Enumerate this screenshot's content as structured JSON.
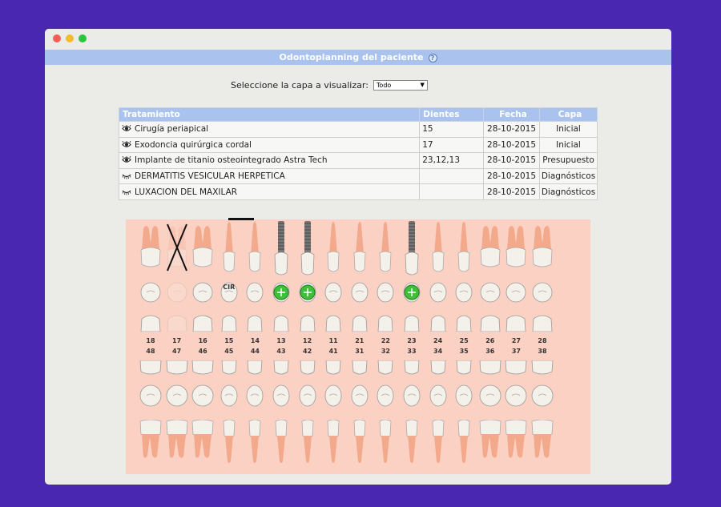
{
  "window": {
    "title": "Odontoplanning del paciente"
  },
  "layer_selector": {
    "label": "Seleccione la capa a visualizar:",
    "value": "Todo"
  },
  "table": {
    "headers": [
      "Tratamiento",
      "Dientes",
      "Fecha",
      "Capa"
    ],
    "rows": [
      {
        "icon": "eye-open-icon",
        "treatment": "Cirugía periapical",
        "teeth": "15",
        "date": "28-10-2015",
        "layer": "Inicial"
      },
      {
        "icon": "eye-open-icon",
        "treatment": "Exodoncia quirúrgica cordal",
        "teeth": "17",
        "date": "28-10-2015",
        "layer": "Inicial"
      },
      {
        "icon": "eye-open-icon",
        "treatment": "Implante de titanio osteointegrado Astra Tech",
        "teeth": "23,12,13",
        "date": "28-10-2015",
        "layer": "Presupuesto"
      },
      {
        "icon": "eye-closed-icon",
        "treatment": "DERMATITIS VESICULAR HERPETICA",
        "teeth": "",
        "date": "28-10-2015",
        "layer": "Diagnósticos"
      },
      {
        "icon": "eye-closed-icon",
        "treatment": "LUXACION DEL MAXILAR",
        "teeth": "",
        "date": "28-10-2015",
        "layer": "Diagnósticos"
      }
    ]
  },
  "odontogram": {
    "upper_numbers": [
      "18",
      "17",
      "16",
      "15",
      "14",
      "13",
      "12",
      "11",
      "21",
      "22",
      "23",
      "24",
      "25",
      "26",
      "27",
      "28"
    ],
    "lower_numbers": [
      "48",
      "47",
      "46",
      "45",
      "44",
      "43",
      "42",
      "41",
      "31",
      "32",
      "33",
      "34",
      "35",
      "36",
      "37",
      "38"
    ],
    "cir_label": "CIR",
    "extracted_tooth": "17",
    "implant_teeth": [
      "13",
      "12",
      "23"
    ],
    "colors": {
      "background": "#fbd1c3",
      "root": "#f2a98c",
      "crown": "#f4f1ea",
      "implant": "#3fbf3a"
    }
  }
}
